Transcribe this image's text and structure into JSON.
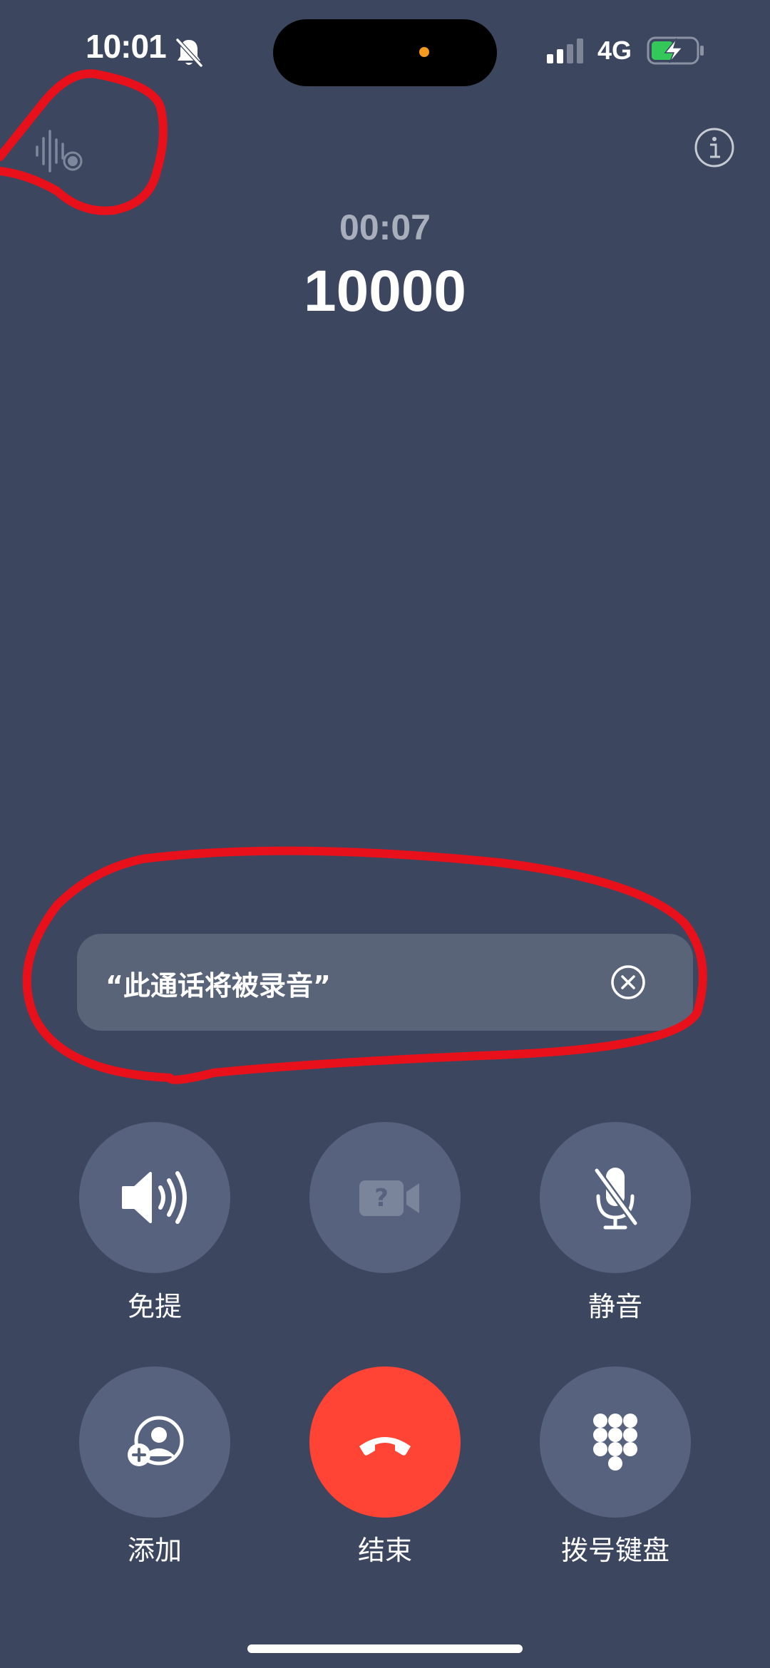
{
  "status_bar": {
    "time": "10:01",
    "network": "4G",
    "silent_icon": "bell-slash-icon",
    "battery_icon": "battery-charging-icon",
    "signal_icon": "cellular-signal-icon"
  },
  "call": {
    "duration": "00:07",
    "number": "10000",
    "recording_icon": "recording-waveform-icon",
    "info_icon": "info-icon"
  },
  "banner": {
    "text": "“此通话将被录音”",
    "close_icon": "close-circle-icon"
  },
  "controls": {
    "speaker": {
      "label": "免提",
      "icon": "speaker-icon"
    },
    "facetime": {
      "label": "",
      "icon": "facetime-unavailable-icon"
    },
    "mute": {
      "label": "静音",
      "icon": "mic-slash-icon"
    },
    "add": {
      "label": "添加",
      "icon": "add-call-icon"
    },
    "end": {
      "label": "结束",
      "icon": "hangup-icon"
    },
    "keypad": {
      "label": "拨号键盘",
      "icon": "keypad-icon"
    }
  },
  "colors": {
    "background": "#3c475f",
    "button": "#56627e",
    "end_call": "#ff4335",
    "island_dot": "#f49a1f",
    "battery_fill": "#34c759",
    "annotation": "#e8101a"
  }
}
